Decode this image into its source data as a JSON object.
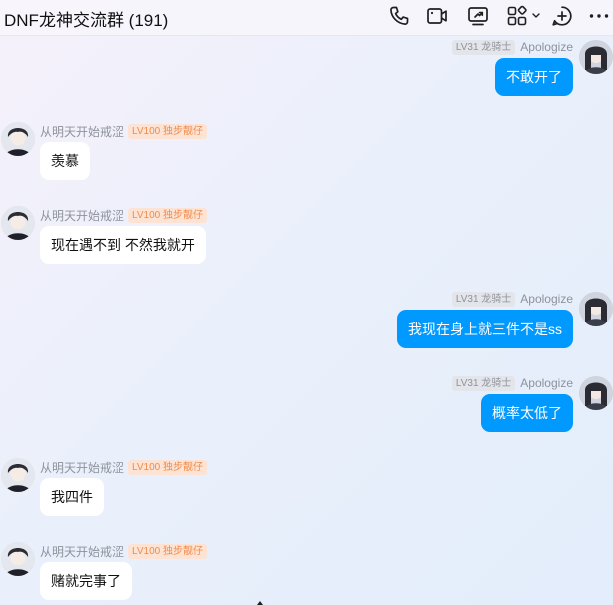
{
  "header": {
    "title": "DNF龙神交流群 (191)",
    "icons": [
      "phone-icon",
      "video-camera-icon",
      "screen-share-icon",
      "apps-grid-icon",
      "chevron-down-icon",
      "add-circle-icon",
      "more-icon"
    ]
  },
  "users": {
    "self": {
      "level": "LV31 龙骑士",
      "nick": "Apologize"
    },
    "other": {
      "nick": "从明天开始戒涩",
      "level": "LV100 独步靓仔"
    }
  },
  "messages": [
    {
      "side": "out",
      "text": "不敢开了"
    },
    {
      "side": "in",
      "text": "羡慕"
    },
    {
      "side": "in",
      "text": "现在遇不到 不然我就开"
    },
    {
      "side": "out",
      "text": "我现在身上就三件不是ss"
    },
    {
      "side": "out",
      "text": "概率太低了"
    },
    {
      "side": "in",
      "text": "我四件"
    },
    {
      "side": "in",
      "text": "赌就完事了"
    }
  ],
  "colors": {
    "accent": "#0099ff",
    "bubble_in": "#ffffff",
    "badge_orange": "#f08c4d",
    "badge_grey": "#8e929b"
  }
}
